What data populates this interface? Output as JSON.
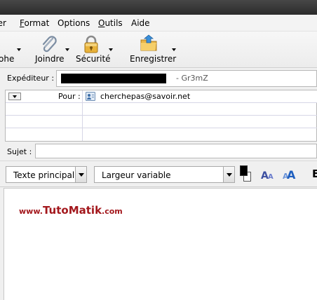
{
  "menu": [
    {
      "label": "rer",
      "accel": ""
    },
    {
      "label": "Format",
      "accel": "F"
    },
    {
      "label": "Options",
      "accel": ""
    },
    {
      "label": "Outils",
      "accel": "O"
    },
    {
      "label": "Aide",
      "accel": ""
    }
  ],
  "toolbar": {
    "partial_label": "ohe",
    "attach_label": "Joindre",
    "security_label": "Sécurité",
    "save_label": "Enregistrer",
    "attach_icon": "paperclip-icon",
    "security_icon": "padlock-icon",
    "save_icon": "folder-save-icon"
  },
  "header": {
    "from_label": "Expéditeur :",
    "from_value": "- Gr3mZ",
    "to_type": "Pour :",
    "to_value": "cherchepas@savoir.net",
    "subject_label": "Sujet :",
    "subject_value": ""
  },
  "format": {
    "paragraph_style": "Texte principal",
    "font": "Largeur variable",
    "text_color": "#000000",
    "background_color": "#ffffff",
    "bold_partial": "E"
  },
  "editor": {
    "watermark_prefix": "www.",
    "watermark_brand": "TutoMatik",
    "watermark_suffix": ".com",
    "watermark_color": "#a3171c"
  }
}
